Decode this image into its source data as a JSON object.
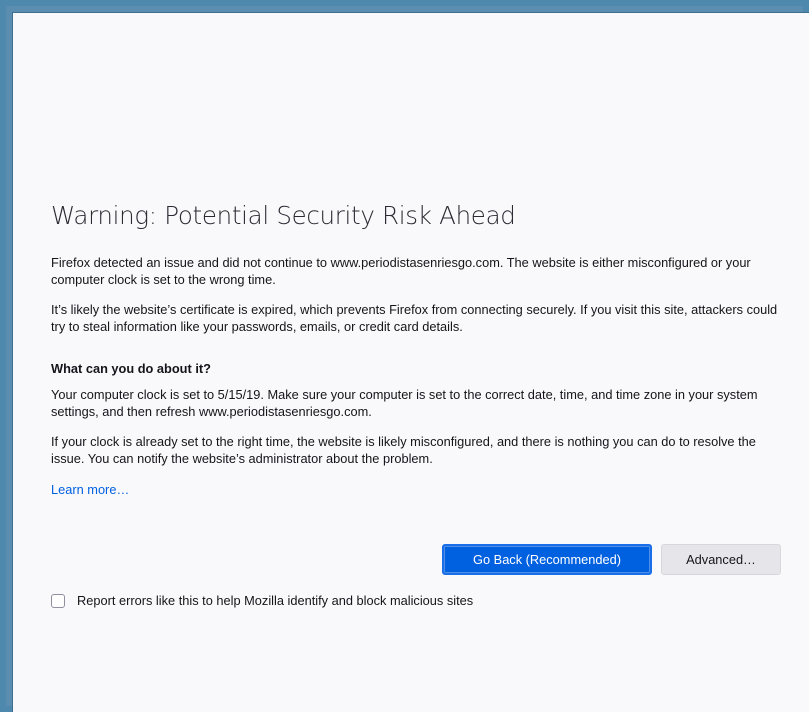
{
  "heading": "Warning: Potential Security Risk Ahead",
  "intro": "Firefox detected an issue and did not continue to www.periodistasenriesgo.com. The website is either misconfigured or your computer clock is set to the wrong time.",
  "certificate_note": "It’s likely the website’s certificate is expired, which prevents Firefox from connecting securely. If you visit this site, attackers could try to steal information like your passwords, emails, or credit card details.",
  "what_can_you_do": {
    "title": "What can you do about it?",
    "clock_note": "Your computer clock is set to 5/15/19. Make sure your computer is set to the correct date, time, and time zone in your system settings, and then refresh www.periodistasenriesgo.com.",
    "misconfig_note": "If your clock is already set to the right time, the website is likely misconfigured, and there is nothing you can do to resolve the issue. You can notify the website’s administrator about the problem."
  },
  "learn_more_label": "Learn more…",
  "buttons": {
    "go_back": "Go Back (Recommended)",
    "advanced": "Advanced…"
  },
  "report": {
    "label": "Report errors like this to help Mozilla identify and block malicious sites",
    "checked": false
  },
  "colors": {
    "frame": "#4f88ad",
    "page_bg": "#f9f9fb",
    "primary_button": "#0061e0",
    "link": "#0060df"
  }
}
